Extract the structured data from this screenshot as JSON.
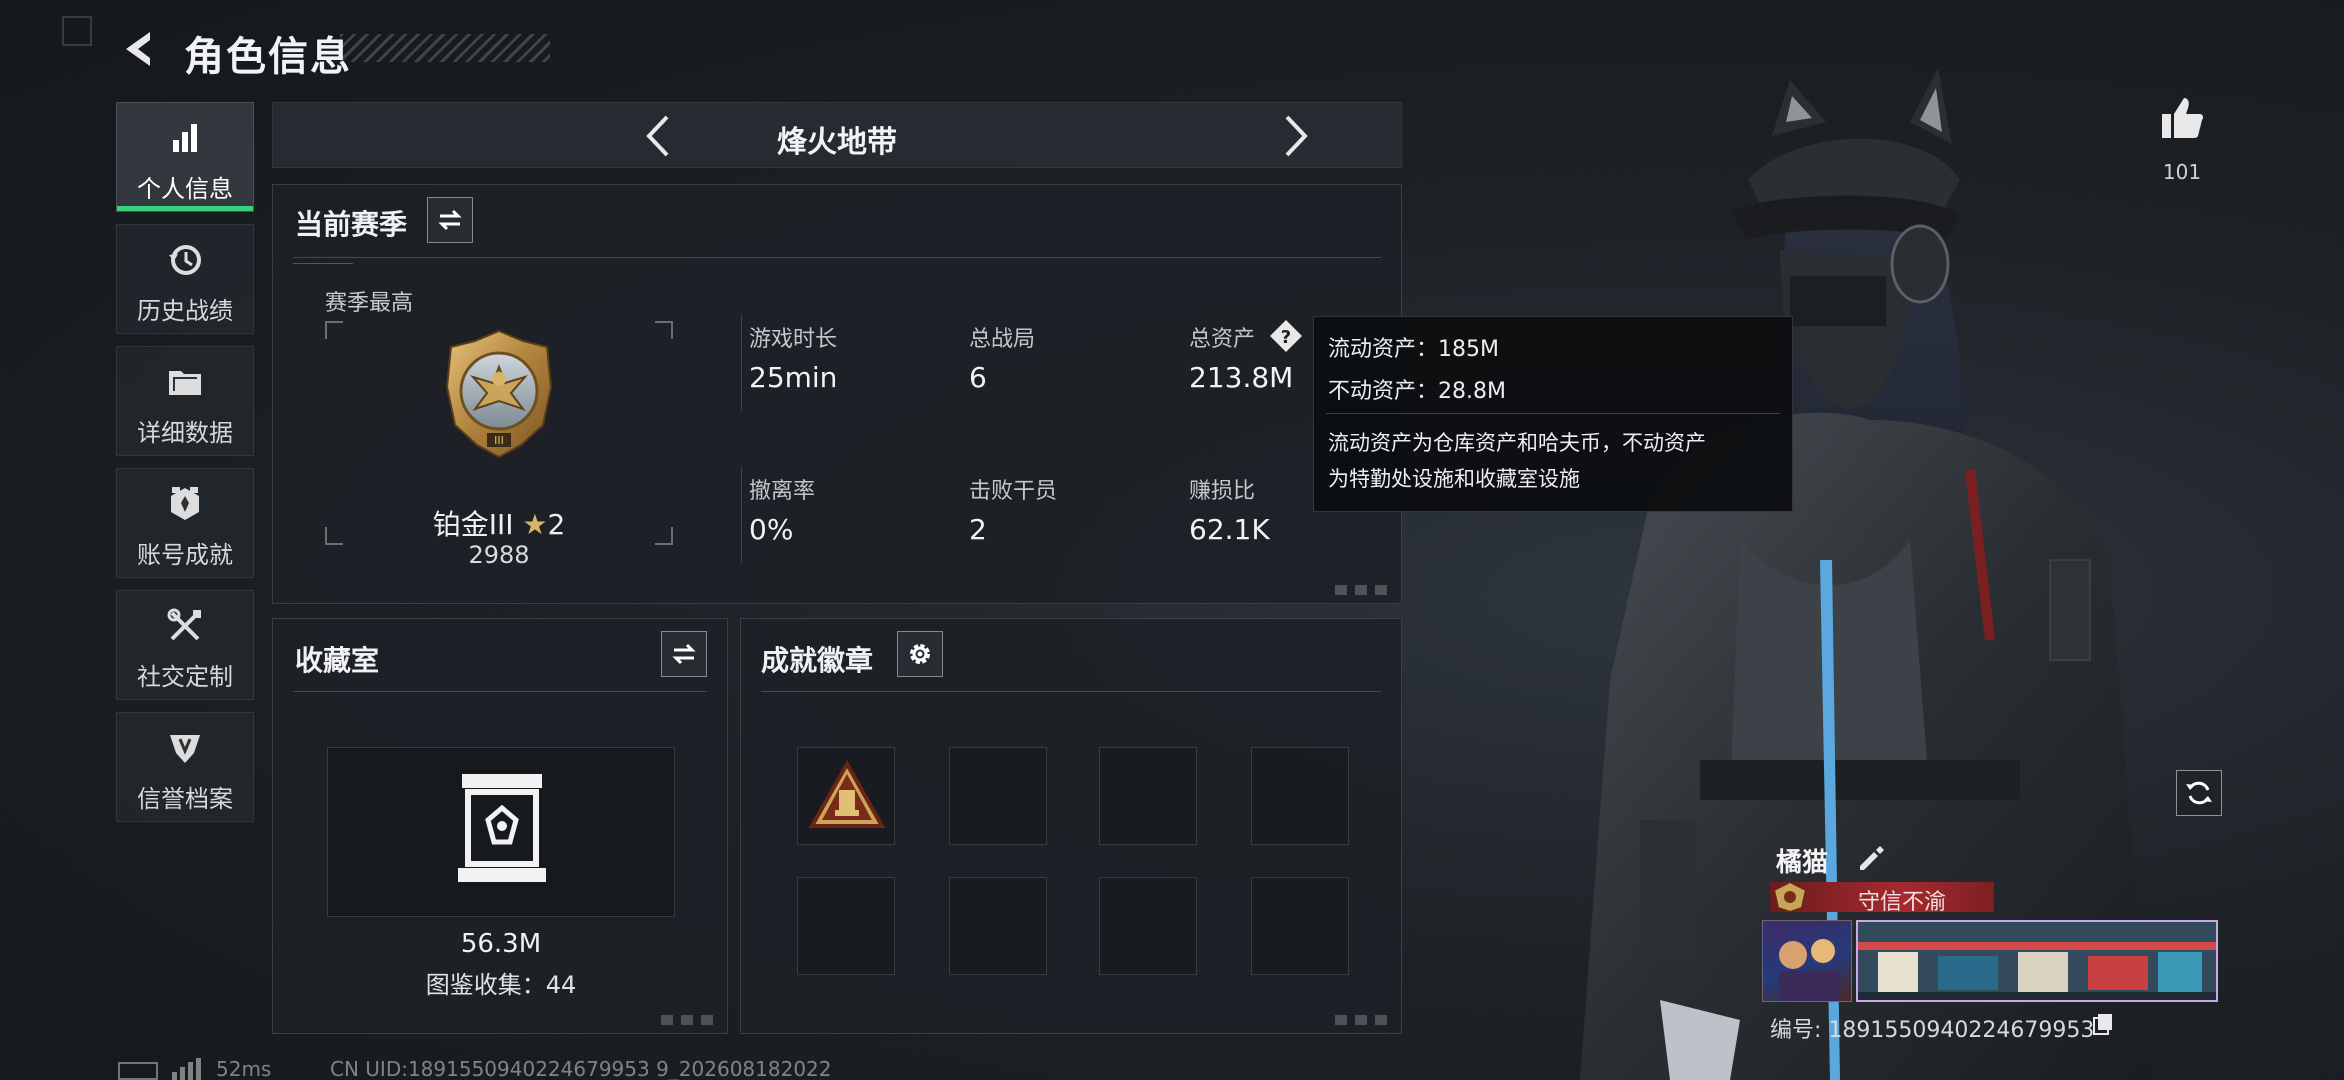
{
  "header": {
    "title": "角色信息"
  },
  "sidebar": {
    "items": [
      {
        "label": "个人信息",
        "icon": "bar-chart-icon",
        "active": true
      },
      {
        "label": "历史战绩",
        "icon": "history-clock-icon"
      },
      {
        "label": "详细数据",
        "icon": "folder-icon"
      },
      {
        "label": "账号成就",
        "icon": "achievement-icon"
      },
      {
        "label": "社交定制",
        "icon": "tools-icon"
      },
      {
        "label": "信誉档案",
        "icon": "credit-shield-icon"
      }
    ]
  },
  "mode": {
    "title": "烽火地带"
  },
  "season": {
    "title": "当前赛季",
    "best_label": "赛季最高",
    "rank": "铂金III",
    "rank_stars": "2",
    "points": "2988",
    "stats": [
      {
        "label": "游戏时长",
        "value": "25min"
      },
      {
        "label": "总战局",
        "value": "6"
      },
      {
        "label": "总资产",
        "value": "213.8M"
      },
      {
        "label": "撤离率",
        "value": "0%"
      },
      {
        "label": "击败干员",
        "value": "2"
      },
      {
        "label": "赚损比",
        "value": "62.1K"
      }
    ]
  },
  "tooltip": {
    "liquid": "流动资产：185M",
    "fixed": "不动资产：28.8M",
    "desc_line1": "流动资产为仓库资产和哈夫币，不动资产",
    "desc_line2": "为特勤处设施和收藏室设施"
  },
  "collection": {
    "title": "收藏室",
    "value": "56.3M",
    "count": "图鉴收集：44"
  },
  "badges": {
    "title": "成就徽章",
    "filled_slots": 1,
    "total_slots": 8
  },
  "likes": {
    "count": "101"
  },
  "player": {
    "name": "橘猫",
    "title": "守信不渝",
    "id": "编号: 1891550940224679953"
  },
  "status": {
    "ping": "52ms",
    "uid": "CN UID:1891550940224679953 9_202608182022"
  },
  "colors": {
    "accent": "#36d27c",
    "title_red": "#a52a2e",
    "gold": "#c9a55a"
  }
}
